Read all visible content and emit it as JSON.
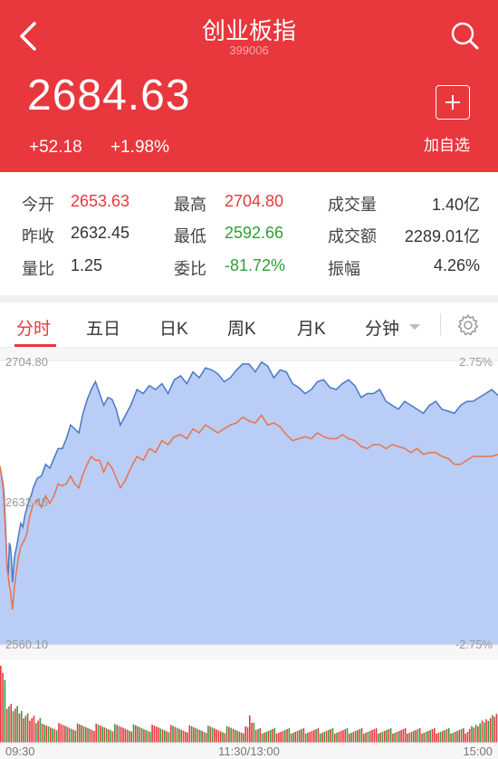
{
  "header": {
    "title": "创业板指",
    "code": "399006",
    "price": "2684.63",
    "change": "+52.18",
    "change_pct": "+1.98%",
    "add_label": "加自选",
    "bg_color": "#e8373d"
  },
  "stats": {
    "rows": [
      [
        {
          "label": "今开",
          "value": "2653.63",
          "color": "#e8373d"
        },
        {
          "label": "最高",
          "value": "2704.80",
          "color": "#e8373d"
        },
        {
          "label": "成交量",
          "value": "1.40亿",
          "color": "#333"
        }
      ],
      [
        {
          "label": "昨收",
          "value": "2632.45",
          "color": "#333"
        },
        {
          "label": "最低",
          "value": "2592.66",
          "color": "#2e9e3a"
        },
        {
          "label": "成交额",
          "value": "2289.01亿",
          "color": "#333"
        }
      ],
      [
        {
          "label": "量比",
          "value": "1.25",
          "color": "#333"
        },
        {
          "label": "委比",
          "value": "-81.72%",
          "color": "#2e9e3a"
        },
        {
          "label": "振幅",
          "value": "4.26%",
          "color": "#333"
        }
      ]
    ]
  },
  "tabs": [
    "分时",
    "五日",
    "日K",
    "周K",
    "月K",
    "分钟"
  ],
  "chart_data": {
    "type": "line",
    "y_top": "2704.80",
    "y_mid": "2632.45",
    "y_bottom": "2560.10",
    "pct_top": "2.75%",
    "pct_bottom": "-2.75%",
    "x_ticks": [
      "09:30",
      "11:30/13:00",
      "15:00"
    ],
    "ylim": [
      2560.1,
      2704.8
    ],
    "prev_close": 2632.45,
    "series": [
      {
        "color": "#4a78c4",
        "fill": "#b9cdf6",
        "x": [
          0,
          1.5,
          2,
          3,
          3.5,
          4,
          4.5,
          5,
          5.5,
          6,
          7,
          8,
          9,
          10,
          11,
          12,
          13,
          14,
          15,
          16,
          18,
          20,
          22,
          24,
          26,
          28,
          30,
          32,
          34,
          36,
          38,
          40,
          42,
          44,
          46,
          48,
          50,
          52,
          54,
          56,
          58,
          60,
          63,
          66,
          69,
          72,
          75,
          78,
          81,
          84,
          87,
          90,
          93,
          96,
          99,
          102,
          105,
          108,
          111,
          114,
          117,
          120,
          123,
          126,
          129,
          132,
          135,
          138,
          141,
          144,
          147,
          150,
          153,
          156,
          159,
          162,
          165,
          168,
          171,
          174,
          177,
          180,
          183,
          186,
          189,
          192,
          195,
          198,
          201,
          204,
          207,
          210,
          213,
          216,
          219,
          222,
          225,
          228,
          231,
          234,
          237,
          240
        ],
        "values": [
          2651,
          2642,
          2636,
          2612,
          2600,
          2596,
          2612,
          2610,
          2604,
          2592,
          2605,
          2610,
          2616,
          2622,
          2620,
          2626,
          2630,
          2634,
          2636,
          2640,
          2645,
          2646,
          2652,
          2650,
          2655,
          2660,
          2660,
          2665,
          2672,
          2670,
          2668,
          2678,
          2685,
          2690,
          2694,
          2688,
          2682,
          2686,
          2685,
          2680,
          2672,
          2676,
          2682,
          2690,
          2688,
          2692,
          2690,
          2693,
          2688,
          2695,
          2697,
          2693,
          2699,
          2696,
          2701,
          2700,
          2698,
          2694,
          2696,
          2700,
          2703,
          2703,
          2699,
          2704,
          2702,
          2696,
          2700,
          2699,
          2693,
          2691,
          2688,
          2690,
          2694,
          2695,
          2691,
          2690,
          2693,
          2695,
          2692,
          2686,
          2688,
          2688,
          2690,
          2684,
          2682,
          2680,
          2684,
          2682,
          2680,
          2678,
          2682,
          2684,
          2680,
          2679,
          2678,
          2682,
          2684,
          2684,
          2686,
          2688,
          2690,
          2687
        ],
        "_pad": null
      },
      {
        "color": "#e8744d",
        "x": [
          0,
          1.5,
          2,
          3,
          3.5,
          4,
          4.5,
          5,
          5.5,
          6,
          7,
          8,
          9,
          10,
          11,
          12,
          13,
          14,
          15,
          16,
          18,
          20,
          22,
          24,
          26,
          28,
          30,
          32,
          34,
          36,
          38,
          40,
          42,
          44,
          46,
          48,
          50,
          52,
          54,
          56,
          58,
          60,
          63,
          66,
          69,
          72,
          75,
          78,
          81,
          84,
          87,
          90,
          93,
          96,
          99,
          102,
          105,
          108,
          111,
          114,
          117,
          120,
          123,
          126,
          129,
          132,
          135,
          138,
          141,
          144,
          147,
          150,
          153,
          156,
          159,
          162,
          165,
          168,
          171,
          174,
          177,
          180,
          183,
          186,
          189,
          192,
          195,
          198,
          201,
          204,
          207,
          210,
          213,
          216,
          219,
          222,
          225,
          228,
          231,
          234,
          237,
          240
        ],
        "values": [
          2651,
          2640,
          2630,
          2610,
          2598,
          2595,
          2590,
          2588,
          2583,
          2578,
          2590,
          2598,
          2605,
          2610,
          2612,
          2614,
          2617,
          2624,
          2628,
          2632,
          2634,
          2630,
          2636,
          2632,
          2636,
          2642,
          2641,
          2642,
          2646,
          2642,
          2640,
          2647,
          2652,
          2656,
          2654,
          2654,
          2648,
          2653,
          2650,
          2645,
          2640,
          2643,
          2650,
          2656,
          2654,
          2660,
          2658,
          2664,
          2662,
          2666,
          2667,
          2665,
          2670,
          2668,
          2672,
          2670,
          2668,
          2670,
          2672,
          2673,
          2676,
          2674,
          2673,
          2677,
          2672,
          2673,
          2671,
          2667,
          2664,
          2665,
          2666,
          2665,
          2668,
          2666,
          2665,
          2665,
          2667,
          2665,
          2664,
          2661,
          2660,
          2662,
          2662,
          2660,
          2662,
          2661,
          2660,
          2658,
          2660,
          2657,
          2658,
          2658,
          2656,
          2655,
          2652,
          2652,
          2654,
          2656,
          2656,
          2656,
          2656,
          2657
        ],
        "_pad": null
      }
    ]
  },
  "volume": {
    "colors": [
      "#e8373d",
      "#2e9e3a"
    ]
  }
}
